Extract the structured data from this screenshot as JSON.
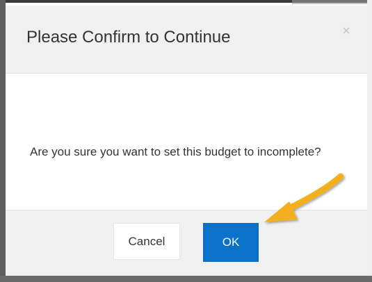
{
  "dialog": {
    "title": "Please Confirm to Continue",
    "close_icon": "close-icon",
    "message": "Are you sure you want to set this budget to incomplete?",
    "cancel_label": "Cancel",
    "ok_label": "OK"
  },
  "colors": {
    "primary": "#0a73c9",
    "header_bg": "#f0f0f0",
    "arrow": "#f2b01e"
  }
}
